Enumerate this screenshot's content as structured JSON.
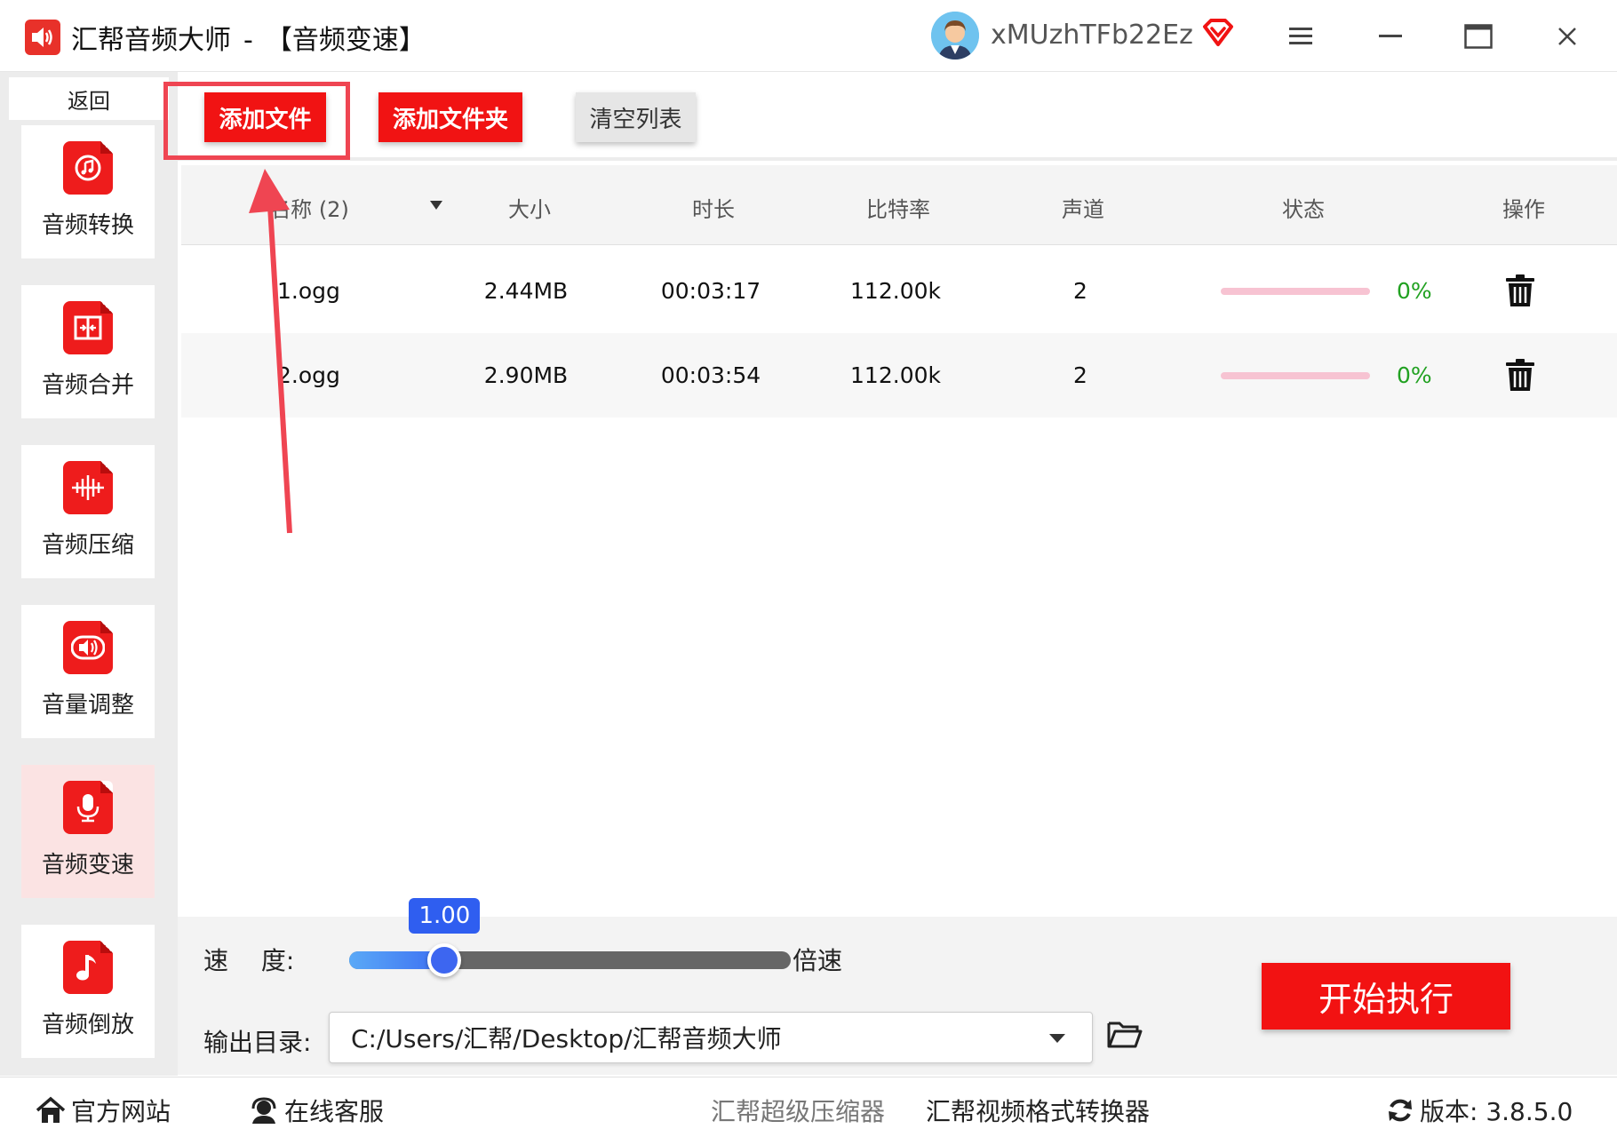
{
  "window": {
    "app_name": "汇帮音频大师",
    "separator": "-",
    "module_title": "【音频变速】",
    "username": "xMUzhTFb22Ez"
  },
  "sidebar": {
    "back_label": "返回",
    "items": [
      {
        "label": "音频转换",
        "icon": "audio-convert-icon"
      },
      {
        "label": "音频合并",
        "icon": "audio-merge-icon"
      },
      {
        "label": "音频压缩",
        "icon": "audio-compress-icon"
      },
      {
        "label": "音量调整",
        "icon": "volume-adjust-icon"
      },
      {
        "label": "音频变速",
        "icon": "microphone-icon",
        "active": true
      },
      {
        "label": "音频倒放",
        "icon": "music-note-icon"
      }
    ]
  },
  "toolbar": {
    "add_file": "添加文件",
    "add_folder": "添加文件夹",
    "clear_list": "清空列表"
  },
  "table": {
    "headers": {
      "name": "名称 (2)",
      "size": "大小",
      "duration": "时长",
      "bitrate": "比特率",
      "channels": "声道",
      "status": "状态",
      "action": "操作"
    },
    "rows": [
      {
        "name": "1.ogg",
        "size": "2.44MB",
        "duration": "00:03:17",
        "bitrate": "112.00k",
        "channels": "2",
        "progress": "0%"
      },
      {
        "name": "2.ogg",
        "size": "2.90MB",
        "duration": "00:03:54",
        "bitrate": "112.00k",
        "channels": "2",
        "progress": "0%"
      }
    ]
  },
  "settings": {
    "speed_label": "速　 度:",
    "speed_value": "1.00",
    "speed_fraction": 0.2,
    "speed_unit": "倍速",
    "output_label": "输出目录:",
    "output_path": "C:/Users/汇帮/Desktop/汇帮音频大师",
    "start_button": "开始执行"
  },
  "footer": {
    "website": "官方网站",
    "support": "在线客服",
    "compressor": "汇帮超级压缩器",
    "video_converter": "汇帮视频格式转换器",
    "version": "版本: 3.8.5.0"
  },
  "colors": {
    "accent_red": "#f11313",
    "slider_blue": "#3d66f0",
    "progress_pink": "#f7c3d2",
    "percent_green": "#21a121"
  }
}
